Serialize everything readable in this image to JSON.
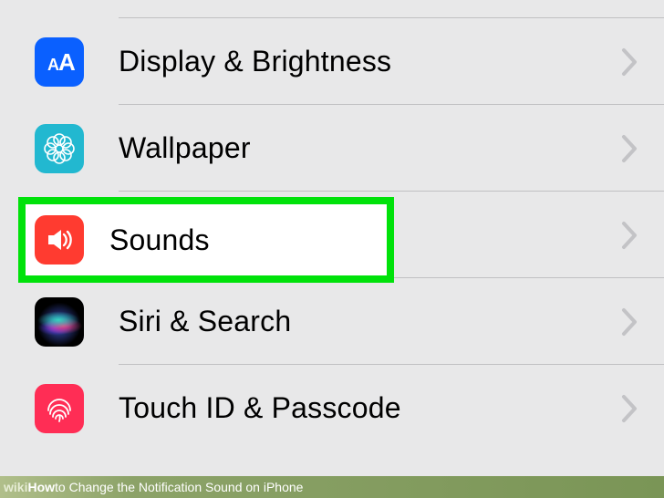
{
  "rows": [
    {
      "id": "display",
      "label": "Display & Brightness",
      "icon": "text-size-icon",
      "bg": "bg-blue"
    },
    {
      "id": "wallpaper",
      "label": "Wallpaper",
      "icon": "flower-icon",
      "bg": "bg-cyan"
    },
    {
      "id": "sounds",
      "label": "Sounds",
      "icon": "speaker-icon",
      "bg": "bg-red",
      "highlighted": true
    },
    {
      "id": "siri",
      "label": "Siri & Search",
      "icon": "siri-icon",
      "bg": "bg-siri"
    },
    {
      "id": "touchid",
      "label": "Touch ID & Passcode",
      "icon": "fingerprint-icon",
      "bg": "bg-red2"
    }
  ],
  "caption": {
    "brand1": "wiki",
    "brand2": "How",
    "text": " to Change the Notification Sound on iPhone"
  },
  "colors": {
    "highlight_border": "#00e20a",
    "chevron": "#c3c3c6"
  }
}
